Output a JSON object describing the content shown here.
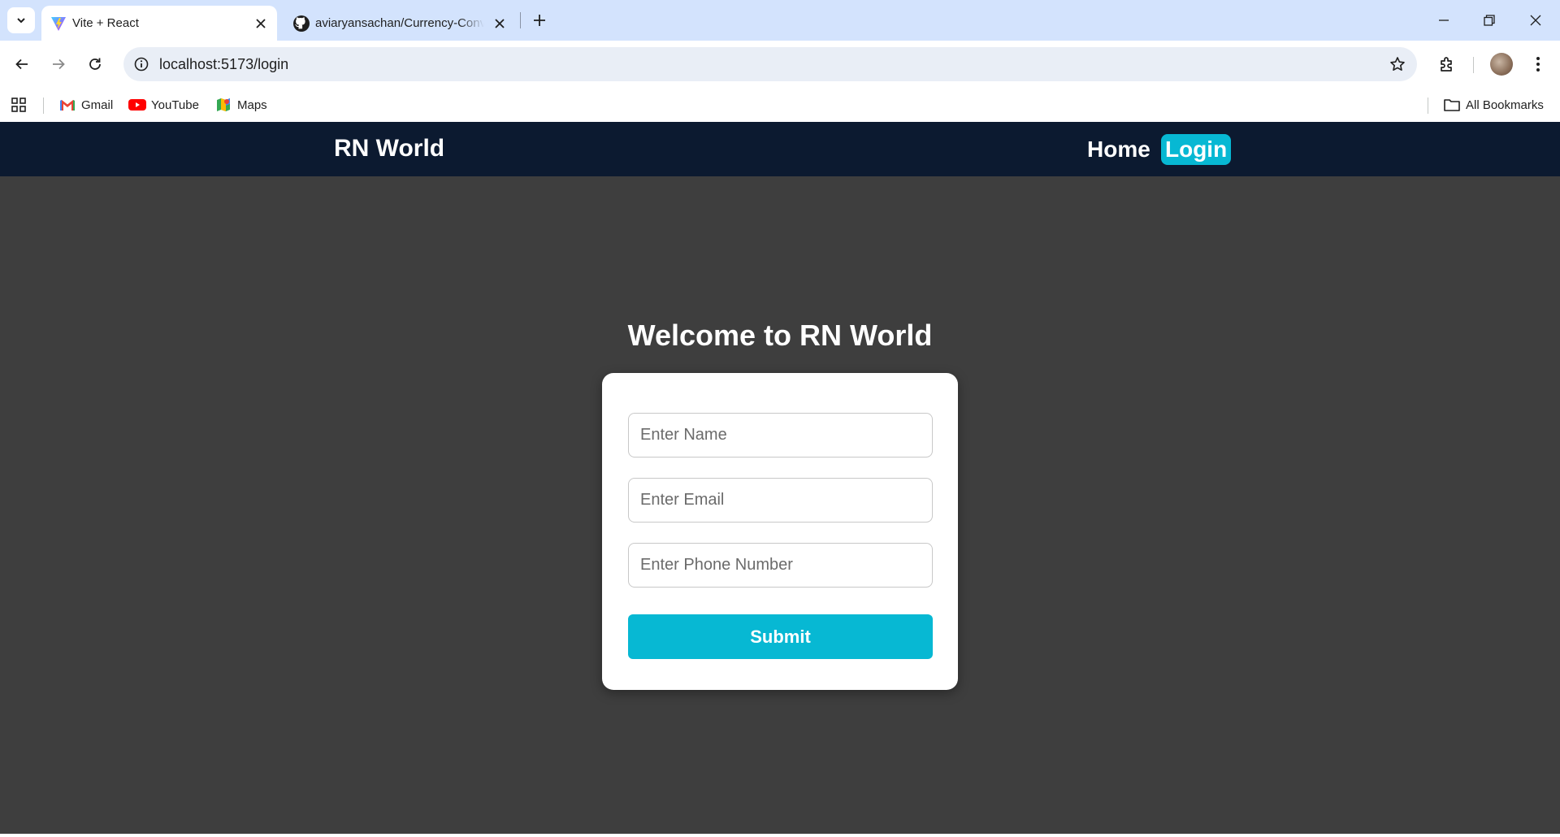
{
  "browser": {
    "tabs": [
      {
        "title": "Vite + React",
        "icon": "vite-icon",
        "active": true
      },
      {
        "title": "aviaryansachan/Currency-Converter",
        "icon": "github-icon",
        "active": false
      }
    ],
    "address": {
      "url": "localhost:5173/login"
    },
    "bookmarks": [
      {
        "label": "Gmail",
        "icon": "gmail-icon"
      },
      {
        "label": "YouTube",
        "icon": "youtube-icon"
      },
      {
        "label": "Maps",
        "icon": "maps-icon"
      }
    ],
    "all_bookmarks_label": "All Bookmarks"
  },
  "site": {
    "brand": "RN World",
    "nav": {
      "home": "Home",
      "login": "Login"
    },
    "accent_color": "#07b8d3",
    "nav_bg_color": "#0c1a30"
  },
  "form": {
    "heading": "Welcome to RN World",
    "name_placeholder": "Enter Name",
    "email_placeholder": "Enter Email",
    "phone_placeholder": "Enter Phone Number",
    "submit_label": "Submit"
  }
}
